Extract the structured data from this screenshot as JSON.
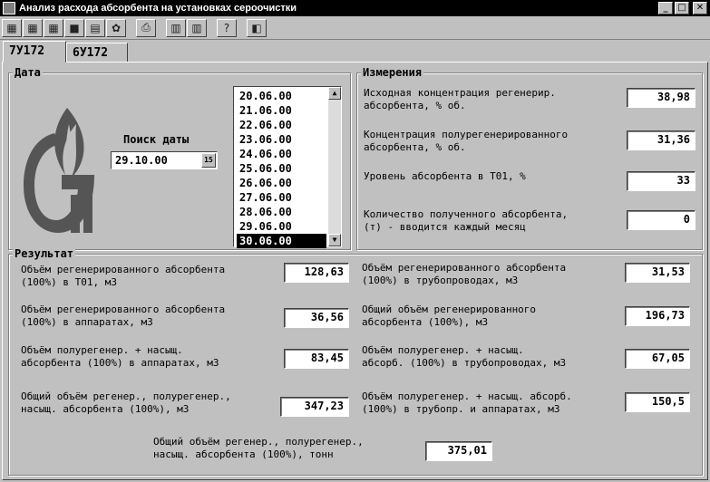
{
  "window": {
    "title": "Анализ расхода абсорбента на установках сероочистки",
    "buttons": {
      "minimize": "_",
      "maximize": "□",
      "close": "✕"
    }
  },
  "toolbar": {
    "icons": [
      "save-icon",
      "save-as-icon",
      "export-icon",
      "delete-icon",
      "open-icon",
      "settings-icon",
      "print-icon",
      "calculator-icon",
      "calculator-2-icon",
      "help-icon",
      "exit-icon"
    ],
    "glyphs": [
      "▦",
      "▦",
      "▦",
      "■",
      "▤",
      "✿",
      "⎙",
      "▥",
      "▥",
      "?",
      "◧"
    ]
  },
  "tabs": [
    "7У172",
    "6У172"
  ],
  "date_group": {
    "label": "Дата",
    "search_label": "Поиск даты",
    "search_value": "29.10.00",
    "calendar_glyph": "15",
    "list": [
      "20.06.00",
      "21.06.00",
      "22.06.00",
      "23.06.00",
      "24.06.00",
      "25.06.00",
      "26.06.00",
      "27.06.00",
      "28.06.00",
      "29.06.00",
      "30.06.00"
    ],
    "selected": "30.06.00",
    "scroll_up": "▲",
    "scroll_down": "▼"
  },
  "measurements": {
    "label": "Измерения",
    "rows": [
      {
        "label": "Исходная концентрация регенерир.\nабсорбента, % об.",
        "value": "38,98"
      },
      {
        "label": "Концентрация полурегенерированного\nабсорбента, % об.",
        "value": "31,36"
      },
      {
        "label": "Уровень абсорбента в Т01, %",
        "value": "33"
      },
      {
        "label": "Количество полученного абсорбента,\n(т) - вводится каждый месяц",
        "value": "0"
      }
    ]
  },
  "results": {
    "label": "Результат",
    "left": [
      {
        "label": "Объём регенерированного абсорбента\n(100%) в Т01, м3",
        "value": "128,63"
      },
      {
        "label": "Объём регенерированного абсорбента\n(100%) в аппаратах, м3",
        "value": "36,56"
      },
      {
        "label": "Объём полурегенер. + насыщ.\nабсорбента (100%) в аппаратах, м3",
        "value": "83,45"
      },
      {
        "label": "Общий объём регенер., полурегенер.,\nнасыщ. абсорбента (100%), м3",
        "value": "347,23"
      }
    ],
    "right": [
      {
        "label": "Объём регенерированного абсорбента\n(100%) в трубопроводах, м3",
        "value": "31,53"
      },
      {
        "label": "Общий объём регенерированного\nабсорбента (100%), м3",
        "value": "196,73"
      },
      {
        "label": "Объём полурегенер. + насыщ.\nабсорб. (100%) в трубопроводах, м3",
        "value": "67,05"
      },
      {
        "label": "Объём полурегенер. + насыщ. абсорб.\n(100%) в трубопр. и аппаратах, м3",
        "value": "150,5"
      }
    ],
    "total": {
      "label": "Общий объём регенер., полурегенер.,\nнасыщ. абсорбента (100%), тонн",
      "value": "375,01"
    }
  }
}
